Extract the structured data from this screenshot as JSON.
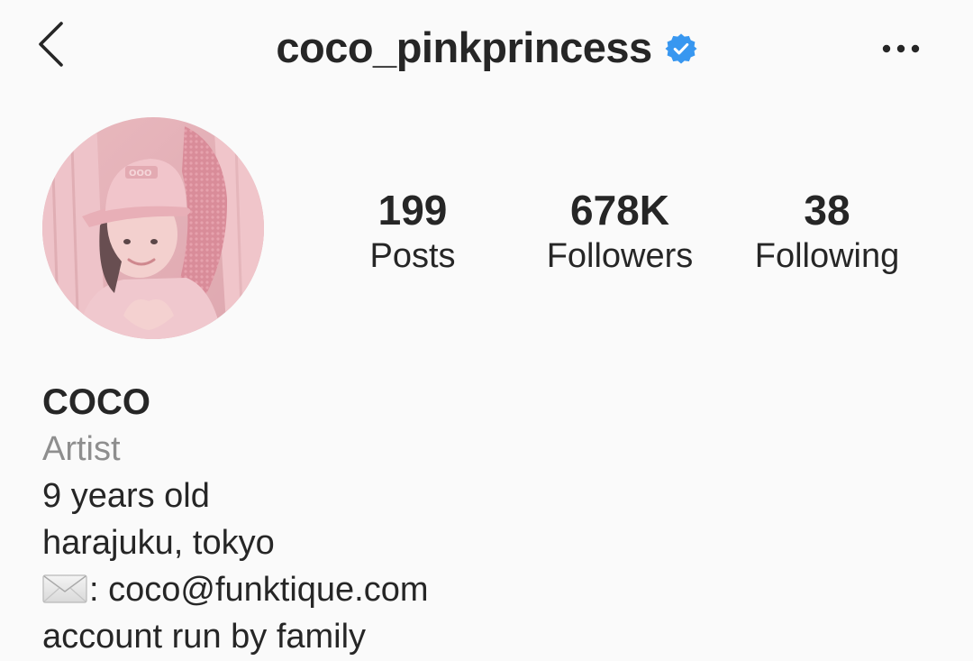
{
  "header": {
    "username": "coco_pinkprincess",
    "back_icon": "chevron-left-icon",
    "verified_icon": "verified-badge-icon",
    "more_icon": "ellipsis-icon"
  },
  "profile": {
    "avatar": "profile-photo",
    "stats": [
      {
        "value": "199",
        "label": "Posts"
      },
      {
        "value": "678K",
        "label": "Followers"
      },
      {
        "value": "38",
        "label": "Following"
      }
    ]
  },
  "bio": {
    "name": "COCO",
    "category": "Artist",
    "lines": [
      "9 years old",
      "harajuku, tokyo",
      ": coco@funktique.com",
      "account run by family"
    ],
    "mail_icon": "envelope-icon"
  },
  "colors": {
    "background": "#fafafa",
    "text": "#262626",
    "secondary_text": "#8e8e8e",
    "verified_blue": "#3897f0",
    "avatar_pink": "#e9b9bf"
  }
}
